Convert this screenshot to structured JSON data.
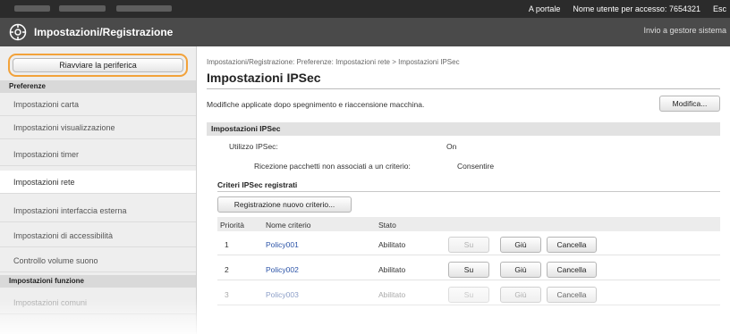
{
  "topbar": {
    "portal_link": "A portale",
    "user_label": "Nome utente per accesso:",
    "user_value": "7654321",
    "logout": "Esc"
  },
  "header": {
    "title": "Impostazioni/Registrazione",
    "admin_link": "Invio a gestore sistema"
  },
  "sidebar": {
    "restart_button": "Riavviare la periferica",
    "section_preferences": "Preferenze",
    "items": [
      {
        "label": "Impostazioni carta"
      },
      {
        "label": "Impostazioni visualizzazione"
      },
      {
        "label": "Impostazioni timer"
      },
      {
        "label": "Impostazioni rete"
      },
      {
        "label": "Impostazioni interfaccia esterna"
      },
      {
        "label": "Impostazioni di accessibilità"
      },
      {
        "label": "Controllo volume suono"
      }
    ],
    "section_functions": "Impostazioni funzione",
    "function_items": [
      {
        "label": "Impostazioni comuni"
      }
    ]
  },
  "main": {
    "breadcrumb": "Impostazioni/Registrazione: Preferenze: Impostazioni rete > Impostazioni IPSec",
    "page_title": "Impostazioni IPSec",
    "notice": "Modifiche applicate dopo spegnimento e riaccensione macchina.",
    "edit_button": "Modifica...",
    "settings_band": "Impostazioni IPSec",
    "use_ipsec_label": "Utilizzo IPSec:",
    "use_ipsec_value": "On",
    "receive_label": "Ricezione pacchetti non associati a un criterio:",
    "receive_value": "Consentire",
    "policies_heading": "Criteri IPSec registrati",
    "register_button": "Registrazione nuovo criterio...",
    "table": {
      "headers": {
        "priority": "Priorità",
        "name": "Nome criterio",
        "status": "Stato"
      },
      "rows": [
        {
          "priority": "1",
          "name": "Policy001",
          "status": "Abilitato",
          "up": "Su",
          "down": "Giù",
          "delete": "Cancella"
        },
        {
          "priority": "2",
          "name": "Policy002",
          "status": "Abilitato",
          "up": "Su",
          "down": "Giù",
          "delete": "Cancella"
        },
        {
          "priority": "3",
          "name": "Policy003",
          "status": "Abilitato",
          "up": "Su",
          "down": "Giù",
          "delete": "Cancella"
        }
      ]
    }
  },
  "colors": {
    "highlight": "#f2a23a",
    "header_bg": "#4a4a4a",
    "link": "#2d55a8"
  }
}
